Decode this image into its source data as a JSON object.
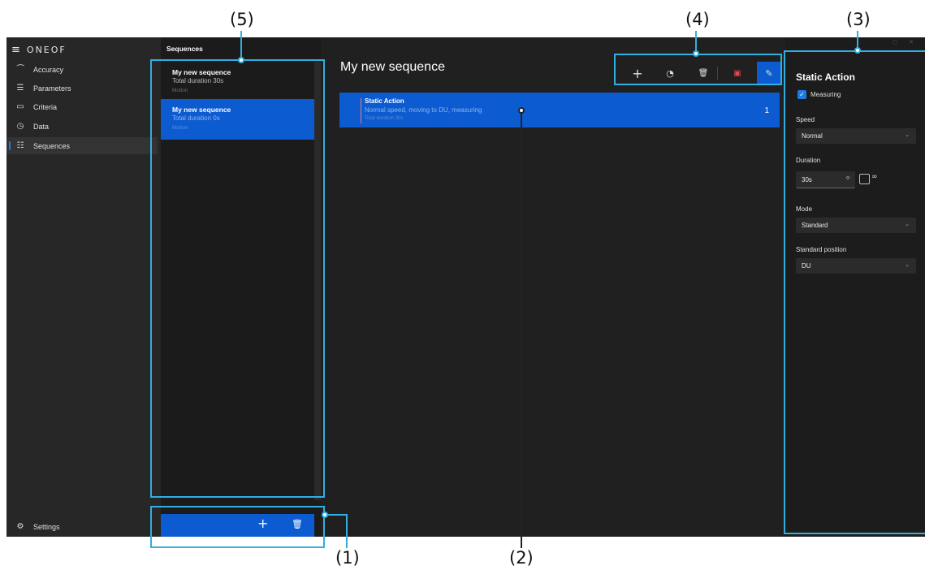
{
  "callouts": {
    "c1": "(1)",
    "c2": "(2)",
    "c3": "(3)",
    "c4": "(4)",
    "c5": "(5)"
  },
  "app": {
    "brand": "ONEOF"
  },
  "nav": {
    "items": [
      {
        "icon": "accuracy-icon",
        "label": "Accuracy"
      },
      {
        "icon": "parameters-icon",
        "label": "Parameters"
      },
      {
        "icon": "criteria-icon",
        "label": "Criteria"
      },
      {
        "icon": "data-icon",
        "label": "Data"
      },
      {
        "icon": "sequences-icon",
        "label": "Sequences",
        "active": true
      }
    ],
    "settings": {
      "icon": "settings-icon",
      "label": "Settings"
    }
  },
  "sequences": {
    "title": "Sequences",
    "items": [
      {
        "name": "My new sequence",
        "duration": "Total duration 30s",
        "type": "Motion"
      },
      {
        "name": "My new sequence",
        "duration": "Total duration 0s",
        "type": "Motion",
        "selected": true
      }
    ]
  },
  "main": {
    "title": "My new sequence",
    "toolbar": [
      "add-icon",
      "speed-icon",
      "delete-icon",
      "save-icon",
      "edit-icon"
    ],
    "action": {
      "title": "Static Action",
      "description": "Normal speed, moving to DU, measuring",
      "duration": "Total duration 30s",
      "index": "1"
    }
  },
  "properties": {
    "title": "Static Action",
    "measuring": {
      "label": "Measuring",
      "checked": true
    },
    "speed": {
      "label": "Speed",
      "value": "Normal"
    },
    "duration": {
      "label": "Duration",
      "value": "30s",
      "infinite_symbol": "∞",
      "infinite_checked": false
    },
    "mode": {
      "label": "Mode",
      "value": "Standard"
    },
    "standard_position": {
      "label": "Standard position",
      "value": "DU"
    }
  },
  "colors": {
    "accent": "#0c5bd0",
    "callout": "#32aee0",
    "background": "#202020"
  }
}
